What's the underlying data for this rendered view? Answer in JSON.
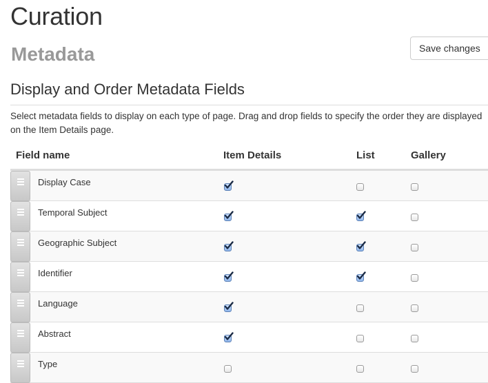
{
  "page": {
    "title": "Curation",
    "subtitle": "Metadata",
    "save_label": "Save changes"
  },
  "section": {
    "heading": "Display and Order Metadata Fields",
    "description": "Select metadata fields to display on each type of page. Drag and drop fields to specify the order they are displayed on the Item Details page."
  },
  "table": {
    "columns": {
      "field_name": "Field name",
      "item_details": "Item Details",
      "list": "List",
      "gallery": "Gallery"
    },
    "rows": [
      {
        "name": "Display Case",
        "item_details": true,
        "list": false,
        "gallery": false
      },
      {
        "name": "Temporal Subject",
        "item_details": true,
        "list": true,
        "gallery": false
      },
      {
        "name": "Geographic Subject",
        "item_details": true,
        "list": true,
        "gallery": false
      },
      {
        "name": "Identifier",
        "item_details": true,
        "list": true,
        "gallery": false
      },
      {
        "name": "Language",
        "item_details": true,
        "list": false,
        "gallery": false
      },
      {
        "name": "Abstract",
        "item_details": true,
        "list": false,
        "gallery": false
      },
      {
        "name": "Type",
        "item_details": false,
        "list": false,
        "gallery": false
      }
    ]
  },
  "icons": {
    "drag_handle": "drag-handle-icon",
    "checkbox_checked": "checkmark-icon"
  }
}
